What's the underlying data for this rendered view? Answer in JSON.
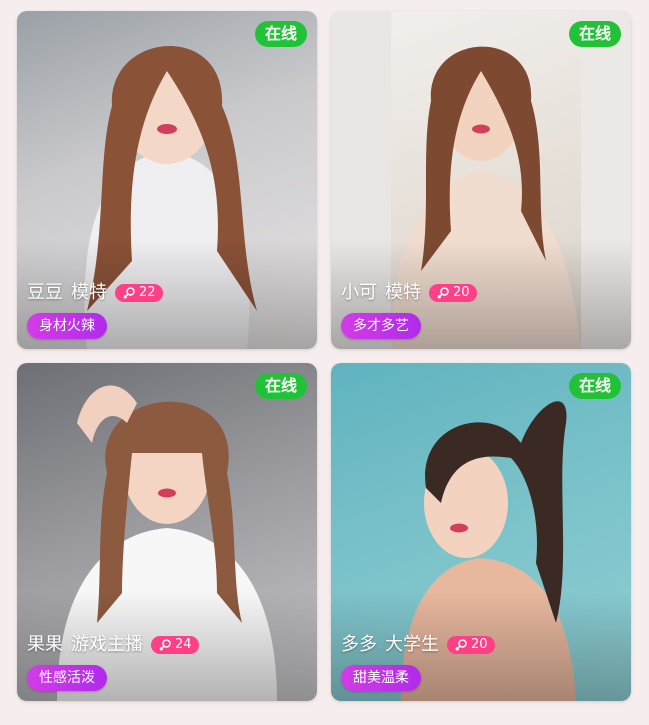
{
  "cards": [
    {
      "status": "在线",
      "name": "豆豆",
      "role": "模特",
      "age": "22",
      "tag": "身材火辣",
      "gender_icon": "female-icon"
    },
    {
      "status": "在线",
      "name": "小可",
      "role": "模特",
      "age": "20",
      "tag": "多才多艺",
      "gender_icon": "female-icon"
    },
    {
      "status": "在线",
      "name": "果果",
      "role": "游戏主播",
      "age": "24",
      "tag": "性感活泼",
      "gender_icon": "female-icon"
    },
    {
      "status": "在线",
      "name": "多多",
      "role": "大学生",
      "age": "20",
      "tag": "甜美温柔",
      "gender_icon": "female-icon"
    }
  ],
  "colors": {
    "online": "#22c238",
    "age_badge": "#ff3f86",
    "tag": "#c233ea"
  }
}
